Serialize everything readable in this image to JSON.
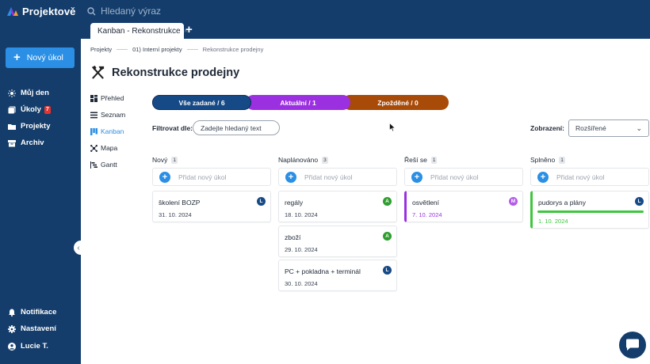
{
  "app": {
    "name": "Projektově"
  },
  "search": {
    "placeholder": "Hledaný výraz"
  },
  "tabs": [
    {
      "label": "Kanban - Rekonstrukce",
      "close": "×"
    }
  ],
  "tab_add": "+",
  "sidebar": {
    "new_task": "Nový úkol",
    "items": [
      {
        "label": "Můj den",
        "icon": "sun-icon"
      },
      {
        "label": "Úkoly",
        "icon": "tasks-icon",
        "badge": "7"
      },
      {
        "label": "Projekty",
        "icon": "folder-icon"
      },
      {
        "label": "Archiv",
        "icon": "archive-icon"
      }
    ],
    "bottom_items": [
      {
        "label": "Notifikace",
        "icon": "bell-icon"
      },
      {
        "label": "Nastavení",
        "icon": "gear-icon"
      },
      {
        "label": "Lucie T.",
        "icon": "user-icon"
      }
    ],
    "collapse": "‹"
  },
  "breadcrumb": [
    "Projekty",
    "01) Interní projekty",
    "Rekonstrukce prodejny"
  ],
  "page": {
    "title": "Rekonstrukce prodejny",
    "icon": "tools-icon"
  },
  "subnav": [
    {
      "label": "Přehled",
      "icon": "overview-icon",
      "active": false
    },
    {
      "label": "Seznam",
      "icon": "list-icon",
      "active": false
    },
    {
      "label": "Kanban",
      "icon": "kanban-icon",
      "active": true
    },
    {
      "label": "Mapa",
      "icon": "map-icon",
      "active": false
    },
    {
      "label": "Gantt",
      "icon": "gantt-icon",
      "active": false
    }
  ],
  "status_pills": [
    {
      "label": "Vše zadané / 6",
      "color": "#164a86"
    },
    {
      "label": "Aktuální / 1",
      "color": "#9b30e0"
    },
    {
      "label": "Zpožděné / 0",
      "color": "#a84a08"
    }
  ],
  "filter": {
    "label": "Filtrovat dle:",
    "placeholder": "Zadejte hledaný text"
  },
  "view": {
    "label": "Zobrazení:",
    "selected": "Rozšířené"
  },
  "add_task_text": "Přidat nový úkol",
  "columns": [
    {
      "title": "Nový",
      "count": "1",
      "cards": [
        {
          "title": "školení BOZP",
          "date": "31. 10. 2024",
          "avatar": "L",
          "avatar_color": "#164a86"
        }
      ]
    },
    {
      "title": "Naplánováno",
      "count": "3",
      "cards": [
        {
          "title": "regály",
          "date": "18. 10. 2024",
          "avatar": "A",
          "avatar_color": "#2e9e2e"
        },
        {
          "title": "zboží",
          "date": "29. 10. 2024",
          "avatar": "A",
          "avatar_color": "#2e9e2e"
        },
        {
          "title": "PC + pokladna + terminál",
          "date": "30. 10. 2024",
          "avatar": "L",
          "avatar_color": "#164a86"
        }
      ]
    },
    {
      "title": "Řeší se",
      "count": "1",
      "cards": [
        {
          "title": "osvětlení",
          "date": "7. 10. 2024",
          "avatar": "M",
          "avatar_color": "#9b30e0",
          "accent": "#9b30e0"
        }
      ]
    },
    {
      "title": "Splněno",
      "count": "1",
      "cards": [
        {
          "title": "pudorys a plány",
          "date": "1. 10. 2024",
          "avatar": "L",
          "avatar_color": "#164a86",
          "accent": "#3ec63e",
          "progress": 1.0
        }
      ]
    }
  ],
  "chat": {
    "icon": "chat-icon"
  }
}
